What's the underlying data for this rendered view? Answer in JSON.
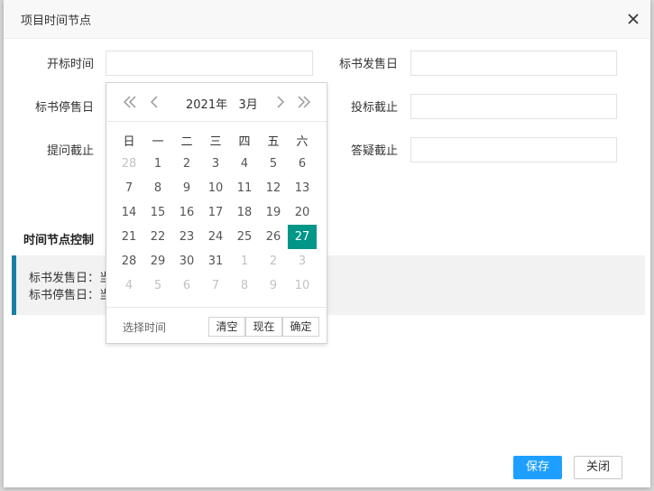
{
  "dialog": {
    "title": "项目时间节点",
    "close_icon": "close-icon"
  },
  "form": {
    "bid_open": {
      "label": "开标时间",
      "value": ""
    },
    "sale_start": {
      "label": "标书发售日",
      "value": ""
    },
    "sale_stop": {
      "label": "标书停售日",
      "value": ""
    },
    "bid_deadline": {
      "label": "投标截止",
      "value": ""
    },
    "question_deadline": {
      "label": "提问截止",
      "value": ""
    },
    "answer_deadline": {
      "label": "答疑截止",
      "value": ""
    }
  },
  "section": {
    "title": "时间节点控制",
    "lines": [
      "标书发售日：当",
      "标书停售日：当"
    ]
  },
  "footer": {
    "save_label": "保存",
    "close_label": "关闭"
  },
  "calendar": {
    "year_label": "2021年",
    "month_label": "3月",
    "weekdays": [
      "日",
      "一",
      "二",
      "三",
      "四",
      "五",
      "六"
    ],
    "weeks": [
      [
        "28",
        "1",
        "2",
        "3",
        "4",
        "5",
        "6"
      ],
      [
        "7",
        "8",
        "9",
        "10",
        "11",
        "12",
        "13"
      ],
      [
        "14",
        "15",
        "16",
        "17",
        "18",
        "19",
        "20"
      ],
      [
        "21",
        "22",
        "23",
        "24",
        "25",
        "26",
        "27"
      ],
      [
        "28",
        "29",
        "30",
        "31",
        "1",
        "2",
        "3"
      ],
      [
        "4",
        "5",
        "6",
        "7",
        "8",
        "9",
        "10"
      ]
    ],
    "other_month_cells": [
      [
        0,
        0
      ],
      [
        4,
        4
      ],
      [
        4,
        5
      ],
      [
        4,
        6
      ],
      [
        5,
        0
      ],
      [
        5,
        1
      ],
      [
        5,
        2
      ],
      [
        5,
        3
      ],
      [
        5,
        4
      ],
      [
        5,
        5
      ],
      [
        5,
        6
      ]
    ],
    "selected_cell": [
      3,
      6
    ],
    "footer_label": "选择时间",
    "clear_label": "清空",
    "now_label": "现在",
    "confirm_label": "确定",
    "colors": {
      "selected": "#009688",
      "primary_button": "#1e9fff",
      "notice_bar": "#1a7fa6"
    }
  }
}
